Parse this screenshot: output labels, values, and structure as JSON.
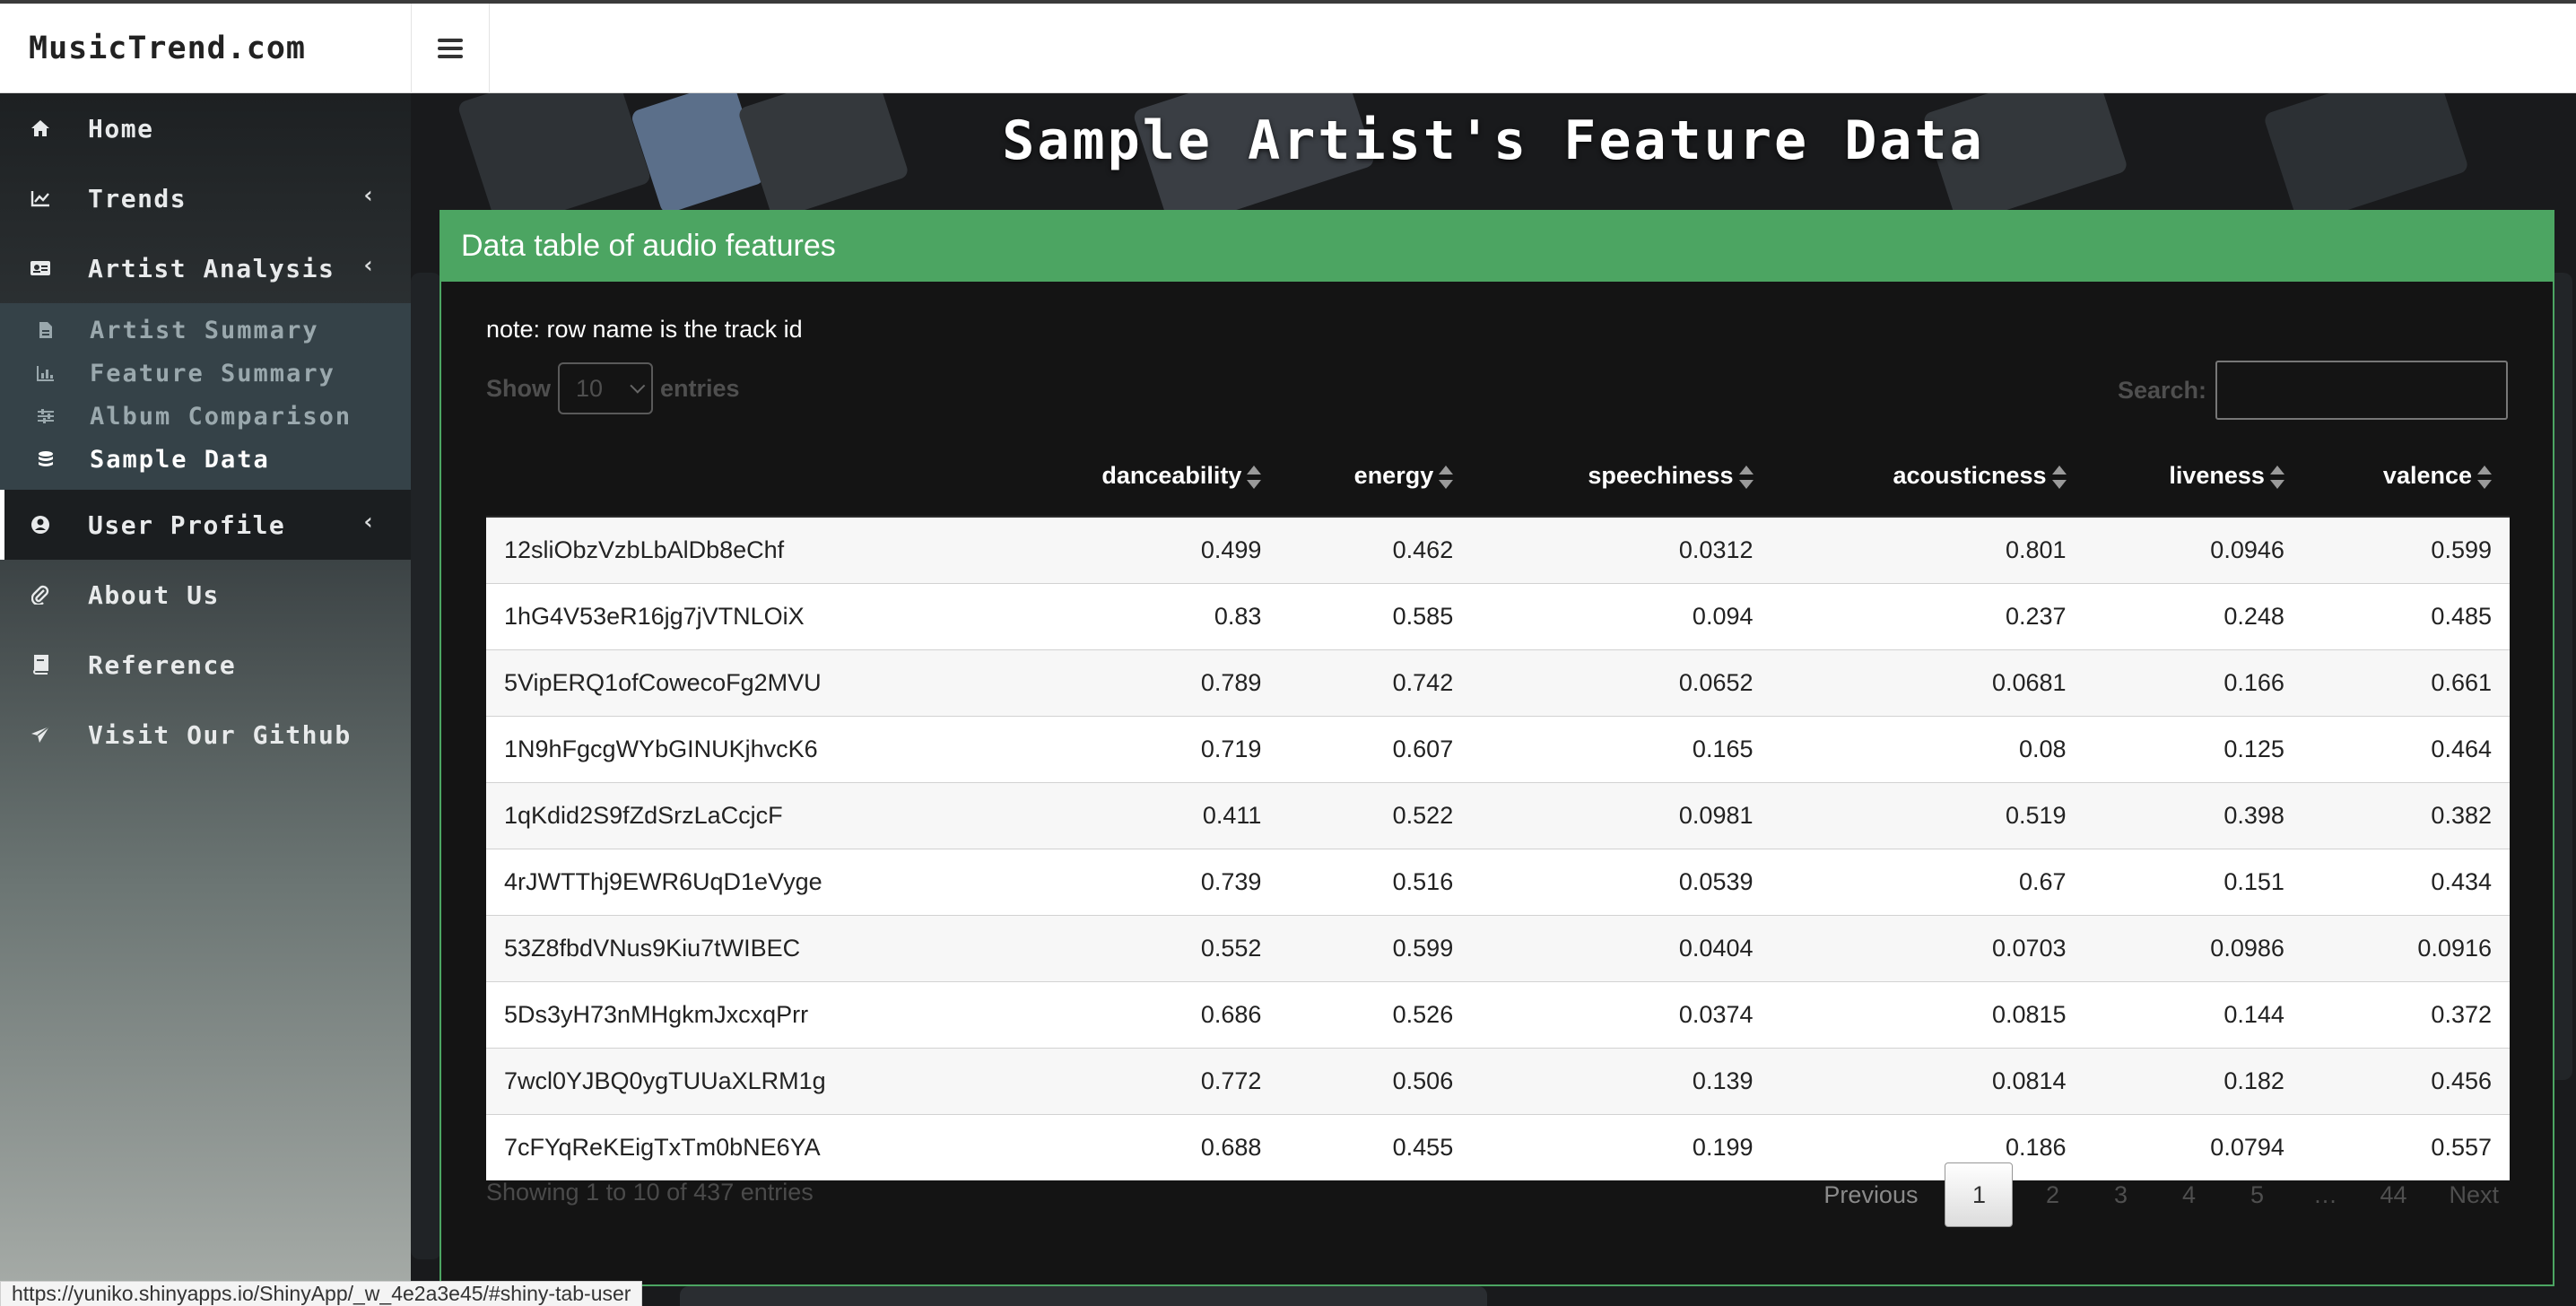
{
  "header": {
    "brand": "MusicTrend.com",
    "toggle_icon": "hamburger-icon"
  },
  "sidebar": {
    "items": [
      {
        "label": "Home",
        "icon": "home-icon"
      },
      {
        "label": "Trends",
        "icon": "line-chart-icon",
        "caret": "‹"
      },
      {
        "label": "Artist Analysis",
        "icon": "id-card-icon",
        "caret": "‹"
      },
      {
        "label": "User Profile",
        "icon": "user-circle-icon",
        "caret": "‹"
      },
      {
        "label": "About Us",
        "icon": "paperclip-icon"
      },
      {
        "label": "Reference",
        "icon": "book-icon"
      },
      {
        "label": "Visit Our Github",
        "icon": "send-icon"
      }
    ],
    "subitems": [
      {
        "label": "Artist Summary",
        "icon": "file-icon"
      },
      {
        "label": "Feature Summary",
        "icon": "bar-chart-icon"
      },
      {
        "label": "Album Comparison",
        "icon": "sliders-icon"
      },
      {
        "label": "Sample Data",
        "icon": "database-icon"
      }
    ]
  },
  "page": {
    "title": "Sample Artist's Feature Data"
  },
  "box": {
    "title": "Data table of audio features",
    "note": "note: row name is the track id"
  },
  "table_controls": {
    "show_label": "Show",
    "length_value": "10",
    "entries_label": "entries",
    "search_label": "Search:",
    "search_value": ""
  },
  "table": {
    "columns": [
      "danceability",
      "energy",
      "speechiness",
      "acousticness",
      "liveness",
      "valence"
    ],
    "rows": [
      {
        "id": "12sliObzVzbLbAlDb8eChf",
        "values": [
          "0.499",
          "0.462",
          "0.0312",
          "0.801",
          "0.0946",
          "0.599"
        ]
      },
      {
        "id": "1hG4V53eR16jg7jVTNLOiX",
        "values": [
          "0.83",
          "0.585",
          "0.094",
          "0.237",
          "0.248",
          "0.485"
        ]
      },
      {
        "id": "5VipERQ1ofCowecoFg2MVU",
        "values": [
          "0.789",
          "0.742",
          "0.0652",
          "0.0681",
          "0.166",
          "0.661"
        ]
      },
      {
        "id": "1N9hFgcgWYbGINUKjhvcK6",
        "values": [
          "0.719",
          "0.607",
          "0.165",
          "0.08",
          "0.125",
          "0.464"
        ]
      },
      {
        "id": "1qKdid2S9fZdSrzLaCcjcF",
        "values": [
          "0.411",
          "0.522",
          "0.0981",
          "0.519",
          "0.398",
          "0.382"
        ]
      },
      {
        "id": "4rJWTThj9EWR6UqD1eVyge",
        "values": [
          "0.739",
          "0.516",
          "0.0539",
          "0.67",
          "0.151",
          "0.434"
        ]
      },
      {
        "id": "53Z8fbdVNus9Kiu7tWIBEC",
        "values": [
          "0.552",
          "0.599",
          "0.0404",
          "0.0703",
          "0.0986",
          "0.0916"
        ]
      },
      {
        "id": "5Ds3yH73nMHgkmJxcxqPrr",
        "values": [
          "0.686",
          "0.526",
          "0.0374",
          "0.0815",
          "0.144",
          "0.372"
        ]
      },
      {
        "id": "7wcl0YJBQ0ygTUUaXLRM1g",
        "values": [
          "0.772",
          "0.506",
          "0.139",
          "0.0814",
          "0.182",
          "0.456"
        ]
      },
      {
        "id": "7cFYqReKEigTxTm0bNE6YA",
        "values": [
          "0.688",
          "0.455",
          "0.199",
          "0.186",
          "0.0794",
          "0.557"
        ]
      }
    ]
  },
  "footer": {
    "info": "Showing 1 to 10 of 437 entries",
    "pagination": {
      "previous": "Previous",
      "pages": [
        "1",
        "2",
        "3",
        "4",
        "5",
        "…",
        "44"
      ],
      "current": "1",
      "next": "Next"
    }
  },
  "statusbar": {
    "url": "https://yuniko.shinyapps.io/ShinyApp/_w_4e2a3e45/#shiny-tab-user"
  },
  "colors": {
    "accent_green": "#4ca562",
    "sidebar_dark": "#1d2022"
  }
}
